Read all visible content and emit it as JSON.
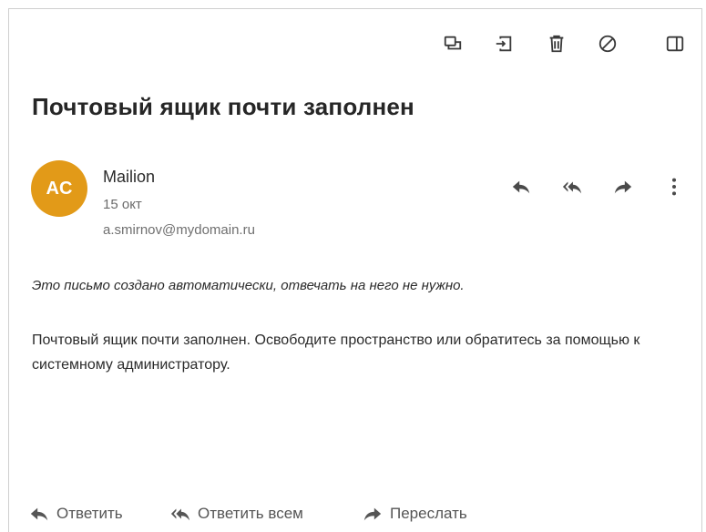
{
  "toolbar": {
    "icons": [
      "move-to-folder-icon",
      "archive-icon",
      "trash-icon",
      "block-icon",
      "panel-toggle-icon"
    ]
  },
  "message": {
    "subject": "Почтовый ящик почти заполнен",
    "avatar_initials": "AC",
    "avatar_color": "#e29a18",
    "sender_name": "Mailion",
    "date": "15 окт",
    "email": "a.smirnov@mydomain.ru",
    "body_note": "Это письмо создано автоматически, отвечать на него не нужно.",
    "body_text": "Почтовый ящик почти заполнен. Освободите пространство или обратитесь за помощью к системному администратору."
  },
  "footer": {
    "reply_label": "Ответить",
    "reply_all_label": "Ответить всем",
    "forward_label": "Переслать"
  }
}
